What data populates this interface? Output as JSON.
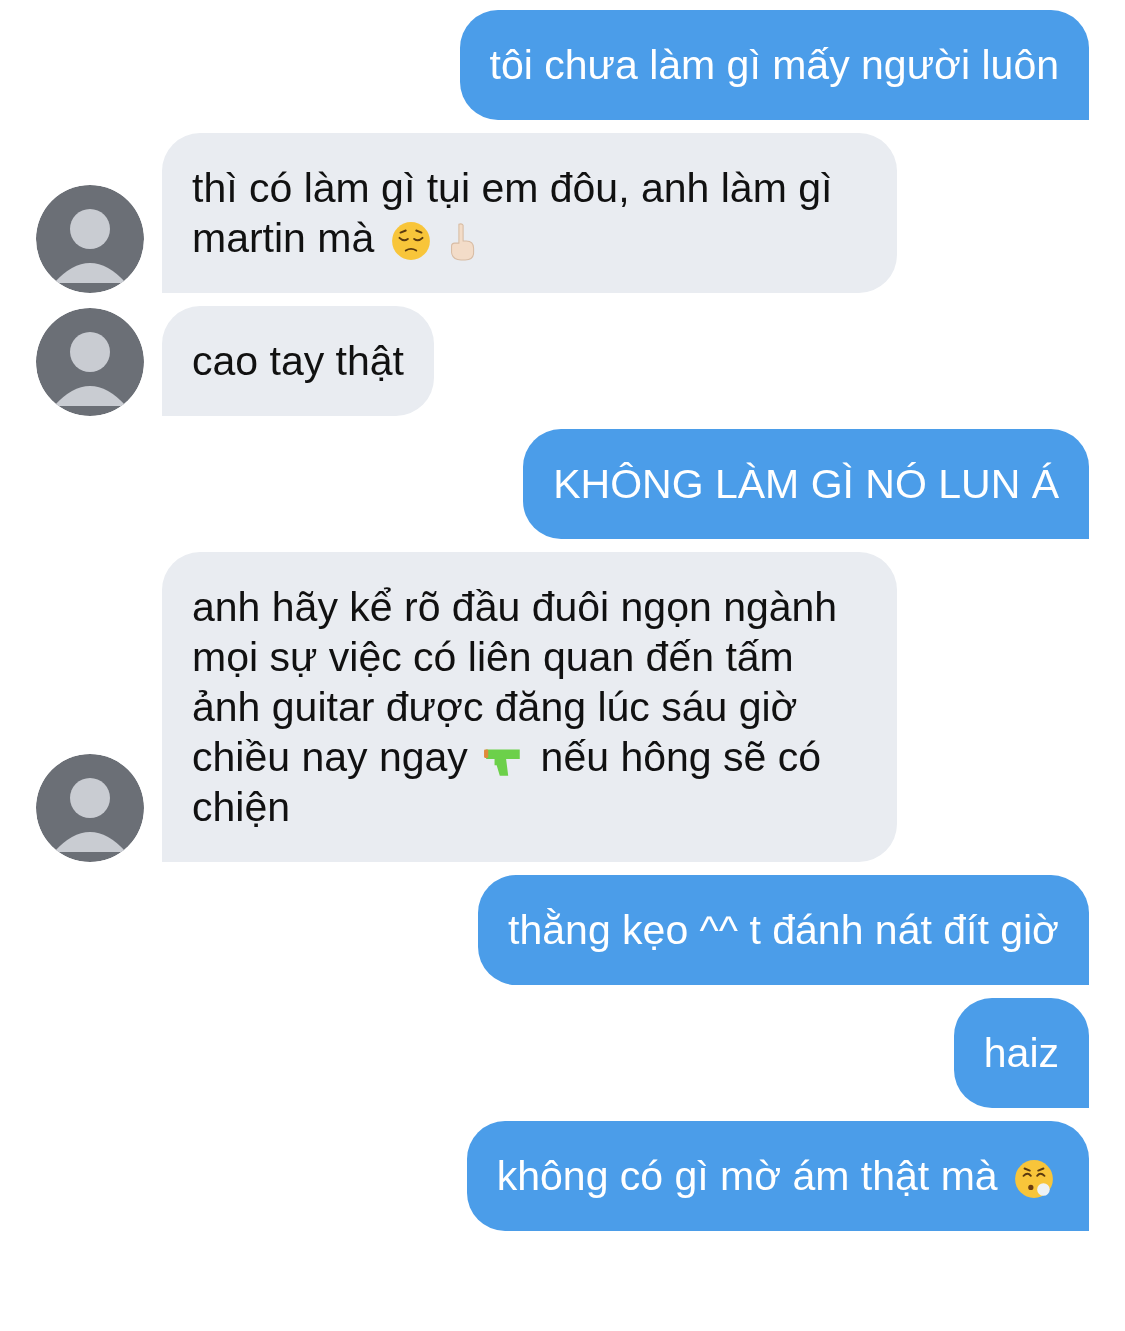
{
  "messages": [
    {
      "kind": "sent",
      "parts": [
        {
          "kind": "text",
          "text": "tôi chưa làm gì mấy người luôn"
        }
      ]
    },
    {
      "kind": "received",
      "avatar": true,
      "parts": [
        {
          "kind": "text",
          "text": "thì có làm gì tụi em đôu, anh làm gì martin mà "
        },
        {
          "kind": "pensive-face"
        },
        {
          "kind": "pointing-up"
        }
      ]
    },
    {
      "kind": "received",
      "avatar": true,
      "parts": [
        {
          "kind": "text",
          "text": "cao tay thật"
        }
      ]
    },
    {
      "kind": "sent",
      "parts": [
        {
          "kind": "text",
          "text": "KHÔNG LÀM GÌ NÓ LUN Á"
        }
      ]
    },
    {
      "kind": "received",
      "avatar": true,
      "parts": [
        {
          "kind": "text",
          "text": "anh hãy kể rõ đầu đuôi ngọn ngành mọi sự việc có liên quan đến tấm ảnh guitar được đăng lúc sáu giờ chiều nay ngay "
        },
        {
          "kind": "water-pistol"
        },
        {
          "kind": "text",
          "text": " nếu hông sẽ có chiện"
        }
      ]
    },
    {
      "kind": "sent",
      "parts": [
        {
          "kind": "text",
          "text": "thằng kẹo ^^ t đánh nát đít giờ"
        }
      ]
    },
    {
      "kind": "sent",
      "parts": [
        {
          "kind": "text",
          "text": "haiz"
        }
      ]
    },
    {
      "kind": "sent",
      "parts": [
        {
          "kind": "text",
          "text": "không có gì mờ ám thật mà "
        },
        {
          "kind": "exhaling-face"
        }
      ]
    }
  ]
}
